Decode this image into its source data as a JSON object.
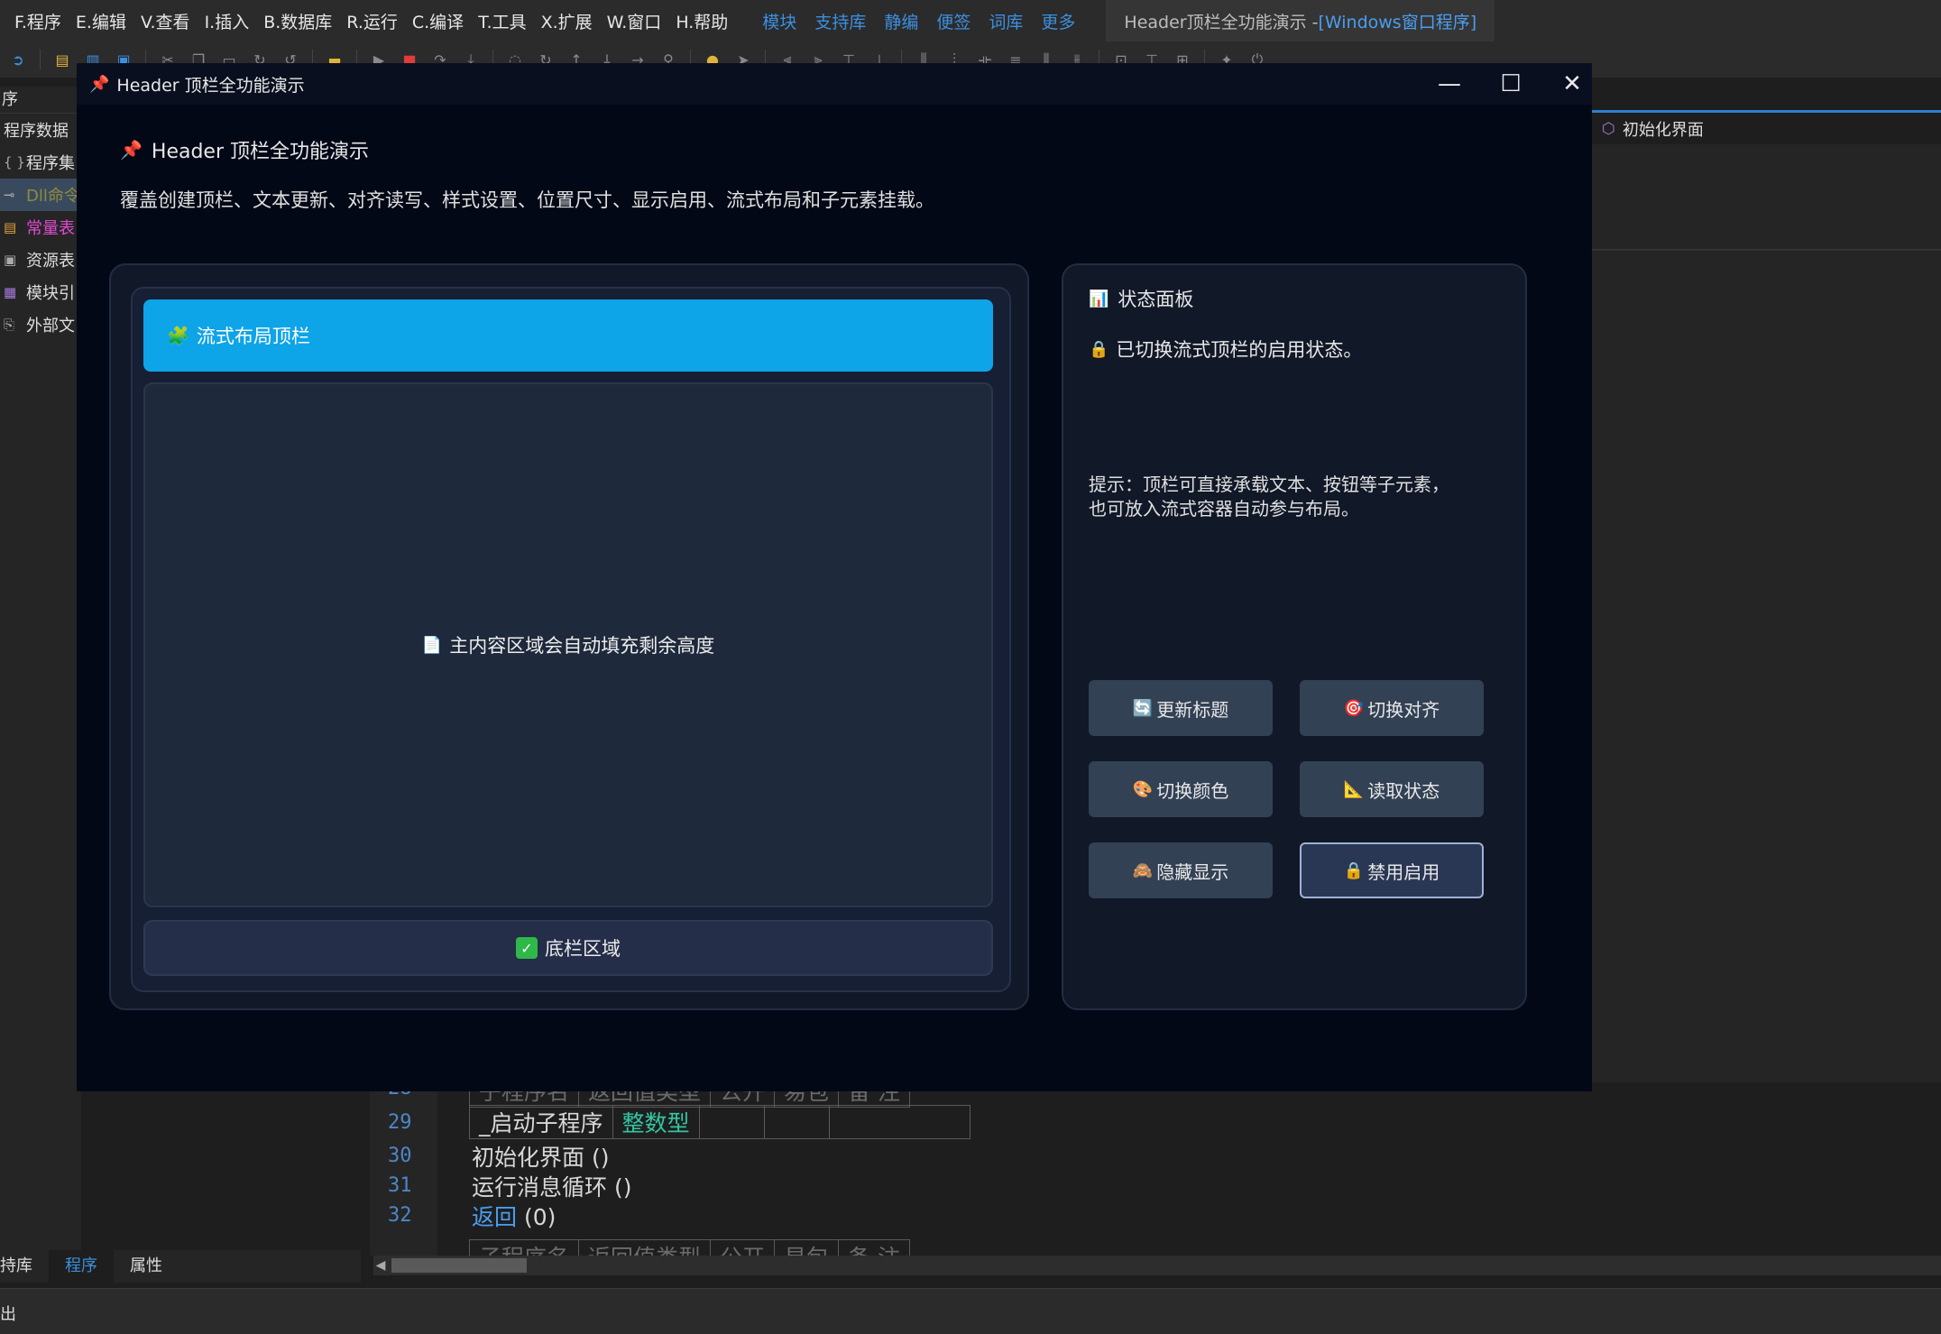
{
  "ide": {
    "menu": [
      "F.程序",
      "E.编辑",
      "V.查看",
      "I.插入",
      "B.数据库",
      "R.运行",
      "C.编译",
      "T.工具",
      "X.扩展",
      "W.窗口",
      "H.帮助"
    ],
    "links": [
      "模块",
      "支持库",
      "静编",
      "便签",
      "词库",
      "更多"
    ],
    "title_prefix": "Header顶栏全功能演示 - ",
    "title_highlight": "[Windows窗口程序]",
    "left_panel": {
      "header": "序",
      "items": [
        {
          "label": "程序数据",
          "icon": ""
        },
        {
          "label": "程序集",
          "icon": "{ }"
        },
        {
          "label": "Dll命令",
          "icon": "⊸"
        },
        {
          "label": "常量表",
          "icon": "▤"
        },
        {
          "label": "资源表",
          "icon": "▣"
        },
        {
          "label": "模块引",
          "icon": "▦"
        },
        {
          "label": "外部文",
          "icon": "⎘"
        }
      ]
    },
    "right_panel": {
      "tab": "初始化界面",
      "tab_icon": "cube-icon"
    },
    "code": {
      "line_numbers": [
        "28",
        "29",
        "30",
        "31",
        "32"
      ],
      "table1_header": [
        "子程序名",
        "返回值类型",
        "公开",
        "易包",
        "备 注"
      ],
      "table1_row": [
        "_启动子程序",
        "整数型",
        "",
        "",
        ""
      ],
      "line30": "初始化界面 ()",
      "line31": "运行消息循环 ()",
      "line32_kw": "返回",
      "line32_rest": " (0)",
      "table2_header": [
        "子程序名",
        "返回值类型",
        "公开",
        "易包",
        "备 注"
      ]
    },
    "bottom_tabs": [
      "持库",
      "程序",
      "属性"
    ],
    "output_label": "出"
  },
  "window": {
    "title": "Header 顶栏全功能演示",
    "controls": {
      "minimize": "—",
      "maximize": "☐",
      "close": "✕"
    }
  },
  "app": {
    "header_title": "Header 顶栏全功能演示",
    "description": "覆盖创建顶栏、文本更新、对齐读写、样式设置、位置尺寸、显示启用、流式布局和子元素挂载。",
    "flow_header": "流式布局顶栏",
    "main_content": "主内容区域会自动填充剩余高度",
    "footer": "底栏区域",
    "status": {
      "title": "状态面板",
      "message": "已切换流式顶栏的启用状态。",
      "hint_line1": "提示：顶栏可直接承载文本、按钮等子元素，",
      "hint_line2": "也可放入流式容器自动参与布局。"
    },
    "buttons": {
      "update_title": "更新标题",
      "toggle_align": "切换对齐",
      "toggle_color": "切换颜色",
      "read_state": "读取状态",
      "hide_show": "隐藏显示",
      "disable_enable": "禁用启用"
    }
  },
  "colors": {
    "flow_header_bg": "#0ea4e8",
    "window_bg": "#030816",
    "card_bg": "#111828",
    "button_bg": "#334155",
    "accent_link": "#3b8fe0"
  }
}
